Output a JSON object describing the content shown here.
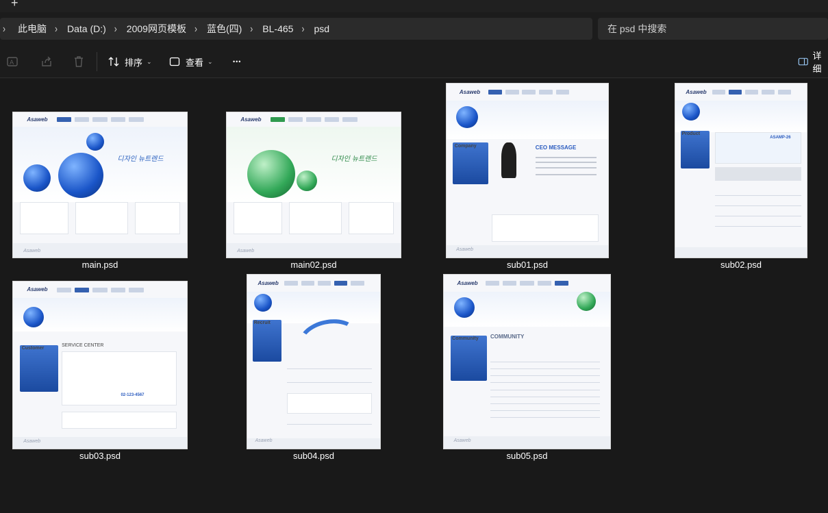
{
  "tabstrip": {
    "new_tab_glyph": "+"
  },
  "address": {
    "leading_chevron": "›",
    "crumbs": [
      "此电脑",
      "Data (D:)",
      "2009网页模板",
      "蓝色(四)",
      "BL-465",
      "psd"
    ],
    "separator": "›"
  },
  "search": {
    "placeholder": "在 psd 中搜索"
  },
  "toolbar": {
    "rename_icon": "rename-icon",
    "share_icon": "share-icon",
    "delete_icon": "delete-icon",
    "sort_label": "排序",
    "view_label": "查看",
    "more_glyph": "•••",
    "details_label": "详细"
  },
  "files": [
    {
      "name": "main.psd",
      "hero_label": "디자인 뉴트렌드"
    },
    {
      "name": "main02.psd",
      "hero_label": "디자인 뉴트렌드"
    },
    {
      "name": "sub01.psd",
      "section_label": "CEO MESSAGE",
      "side_label": "Company"
    },
    {
      "name": "sub02.psd",
      "side_label": "Product",
      "product_label": "ASAMP-26"
    },
    {
      "name": "sub03.psd",
      "side_label": "Customer",
      "section_label": "SERVICE CENTER",
      "phone": "02-123-4567"
    },
    {
      "name": "sub04.psd",
      "side_label": "Recruit"
    },
    {
      "name": "sub05.psd",
      "side_label": "Community",
      "section_label": "COMMUNITY"
    }
  ],
  "thumb_brand": "Asaweb",
  "colors": {
    "background": "#191919",
    "panel": "#2b2b2b",
    "accent_blue": "#2d63c0"
  }
}
